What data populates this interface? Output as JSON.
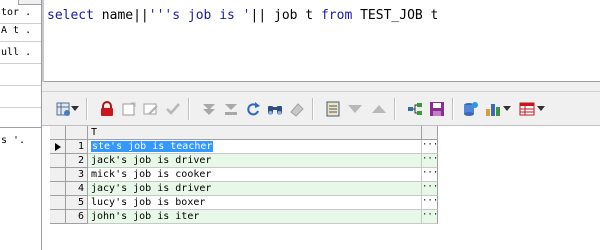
{
  "left_panel": {
    "items": [
      "tor .",
      "A t .",
      "ull .",
      "",
      ""
    ],
    "lower_item": "s '.  "
  },
  "editor": {
    "sql_parts": {
      "kw1": "select",
      "mid1": " name||",
      "str1": "'''s job is '",
      "mid2": "|| job t ",
      "kw2": "from",
      "mid3": " TEST_JOB t"
    }
  },
  "toolbar": {
    "icons": [
      "grid-options-icon",
      "dropdown-arrow-icon",
      "lock-icon",
      "add-record-icon",
      "edit-record-icon",
      "post-check-icon",
      "first-record-icon",
      "last-record-icon",
      "refresh-icon",
      "find-icon",
      "clear-icon",
      "single-record-view-icon",
      "move-down-icon",
      "move-up-icon",
      "query-tree-icon",
      "save-icon",
      "export-icon",
      "chart-icon",
      "dropdown-arrow-icon",
      "table-icon",
      "dropdown-arrow-icon"
    ]
  },
  "grid": {
    "column_header": "T",
    "rows": [
      {
        "num": "1",
        "value": "ste's job is teacher",
        "current": true
      },
      {
        "num": "2",
        "value": "jack's job is driver",
        "current": false
      },
      {
        "num": "3",
        "value": "mick's job is cooker",
        "current": false
      },
      {
        "num": "4",
        "value": "jacy's job is driver",
        "current": false
      },
      {
        "num": "5",
        "value": "lucy's job is boxer",
        "current": false
      },
      {
        "num": "6",
        "value": "john's job is iter",
        "current": false
      }
    ],
    "cell_button": "···"
  },
  "colors": {
    "selection": "#3399ff",
    "alt_row": "#e8f8e8",
    "keyword": "#1a1aa6"
  }
}
